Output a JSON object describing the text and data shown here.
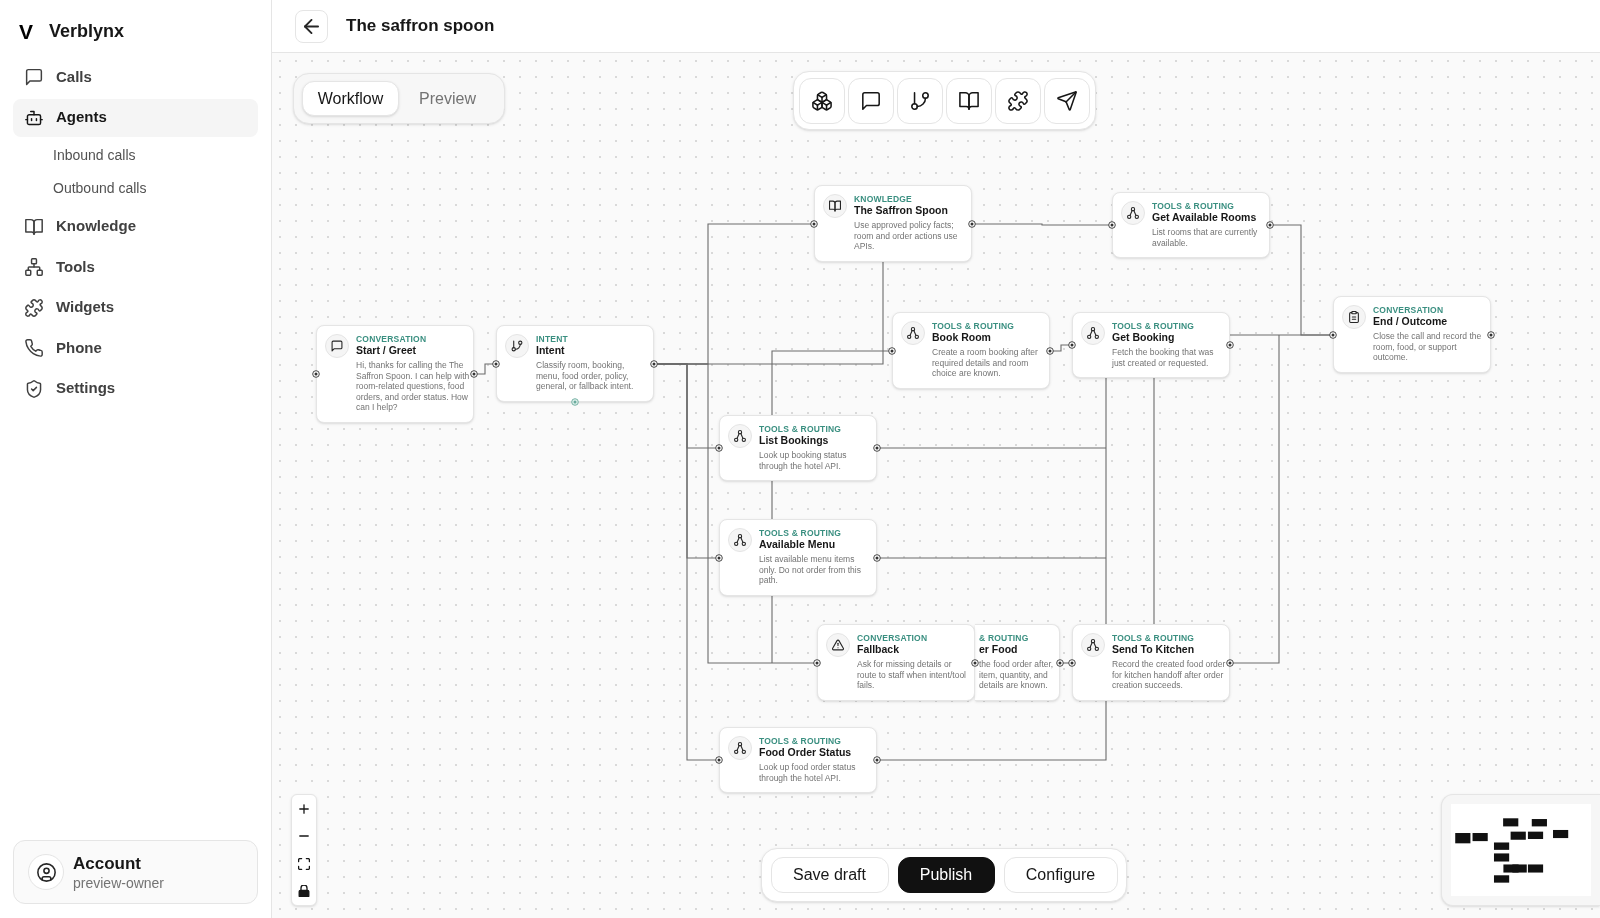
{
  "sidebar": {
    "logo": "V",
    "brand": "Verblynx",
    "items": [
      {
        "label": "Calls",
        "selected": false
      },
      {
        "label": "Agents",
        "selected": true,
        "children": [
          {
            "label": "Inbound calls",
            "selected": false
          },
          {
            "label": "Outbound calls",
            "selected": false
          }
        ]
      },
      {
        "label": "Knowledge",
        "selected": false
      },
      {
        "label": "Tools",
        "selected": false
      },
      {
        "label": "Widgets",
        "selected": false
      },
      {
        "label": "Phone",
        "selected": false
      },
      {
        "label": "Settings",
        "selected": false
      }
    ],
    "account": {
      "title": "Account",
      "subtitle": "preview-owner"
    }
  },
  "header": {
    "title": "The saffron spoon"
  },
  "view_tabs": [
    {
      "label": "Workflow",
      "selected": true
    },
    {
      "label": "Preview",
      "selected": false
    }
  ],
  "workflow": {
    "nodes": [
      {
        "kind": "start",
        "category": "CONVERSATION",
        "title": "Start / Greet",
        "description": "Hi, thanks for calling the The Saffron Spoon. I can help with room-related questions, food orders, and order status. How can I help?"
      },
      {
        "kind": "intent",
        "category": "INTENT",
        "title": "Intent",
        "description": "Classify room, booking, menu, food order, policy, general, or fallback intent."
      },
      {
        "kind": "knowledge",
        "category": "KNOWLEDGE",
        "title": "The Saffron Spoon",
        "description": "Use approved policy facts; room and order actions use APIs."
      },
      {
        "kind": "tool",
        "category": "TOOLS & ROUTING",
        "title": "Get Available Rooms",
        "description": "List rooms that are currently available."
      },
      {
        "kind": "tool",
        "category": "TOOLS & ROUTING",
        "title": "Book Room",
        "description": "Create a room booking after required details and room choice are known."
      },
      {
        "kind": "tool",
        "category": "TOOLS & ROUTING",
        "title": "Get Booking",
        "description": "Fetch the booking that was just created or requested."
      },
      {
        "kind": "end",
        "category": "CONVERSATION",
        "title": "End / Outcome",
        "description": "Close the call and record the room, food, or support outcome."
      },
      {
        "kind": "tool",
        "category": "TOOLS & ROUTING",
        "title": "List Bookings",
        "description": "Look up booking status through the hotel API."
      },
      {
        "kind": "tool",
        "category": "TOOLS & ROUTING",
        "title": "Available Menu",
        "description": "List available menu items only. Do not order from this path."
      },
      {
        "kind": "fallback",
        "category": "CONVERSATION",
        "title": "Fallback",
        "description": "Ask for missing details or route to staff when intent/tool fails."
      },
      {
        "category": "& ROUTING",
        "title": "er Food",
        "description": "the food order after, item, quantity, and details are known."
      },
      {
        "kind": "tool",
        "category": "TOOLS & ROUTING",
        "title": "Send To Kitchen",
        "description": "Record the created food order for kitchen handoff after order creation succeeds."
      },
      {
        "kind": "tool",
        "category": "TOOLS & ROUTING",
        "title": "Food Order Status",
        "description": "Look up food order status through the hotel API."
      }
    ]
  },
  "actions": [
    {
      "label": "Save draft",
      "kind": "secondary"
    },
    {
      "label": "Publish",
      "kind": "primary"
    },
    {
      "label": "Configure",
      "kind": "secondary"
    }
  ]
}
